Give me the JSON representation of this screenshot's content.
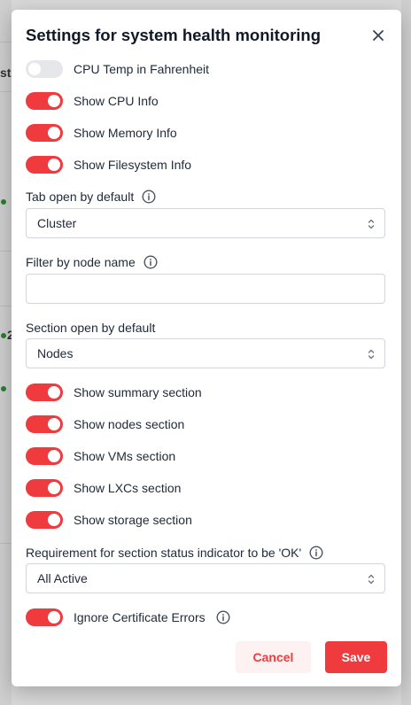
{
  "background": {
    "peek_texts": [
      "st",
      "2"
    ]
  },
  "modal": {
    "title": "Settings for system health monitoring",
    "close_icon": "close-icon",
    "toggles_top": [
      {
        "label": "CPU Temp in Fahrenheit",
        "on": false
      },
      {
        "label": "Show CPU Info",
        "on": true
      },
      {
        "label": "Show Memory Info",
        "on": true
      },
      {
        "label": "Show Filesystem Info",
        "on": true
      }
    ],
    "tab_default": {
      "label": "Tab open by default",
      "value": "Cluster"
    },
    "node_filter": {
      "label": "Filter by node name",
      "value": "",
      "placeholder": ""
    },
    "section_default": {
      "label": "Section open by default",
      "value": "Nodes"
    },
    "toggles_sections": [
      {
        "label": "Show summary section",
        "on": true
      },
      {
        "label": "Show nodes section",
        "on": true
      },
      {
        "label": "Show VMs section",
        "on": true
      },
      {
        "label": "Show LXCs section",
        "on": true
      },
      {
        "label": "Show storage section",
        "on": true
      }
    ],
    "status_requirement": {
      "label": "Requirement for section status indicator to be 'OK'",
      "value": "All Active"
    },
    "ignore_cert": {
      "label": "Ignore Certificate Errors",
      "on": true
    },
    "buttons": {
      "cancel": "Cancel",
      "save": "Save"
    }
  },
  "colors": {
    "accent": "#ef3a3e",
    "toggle_off": "#e5e7eb",
    "cancel_bg": "#fdf1f1"
  }
}
